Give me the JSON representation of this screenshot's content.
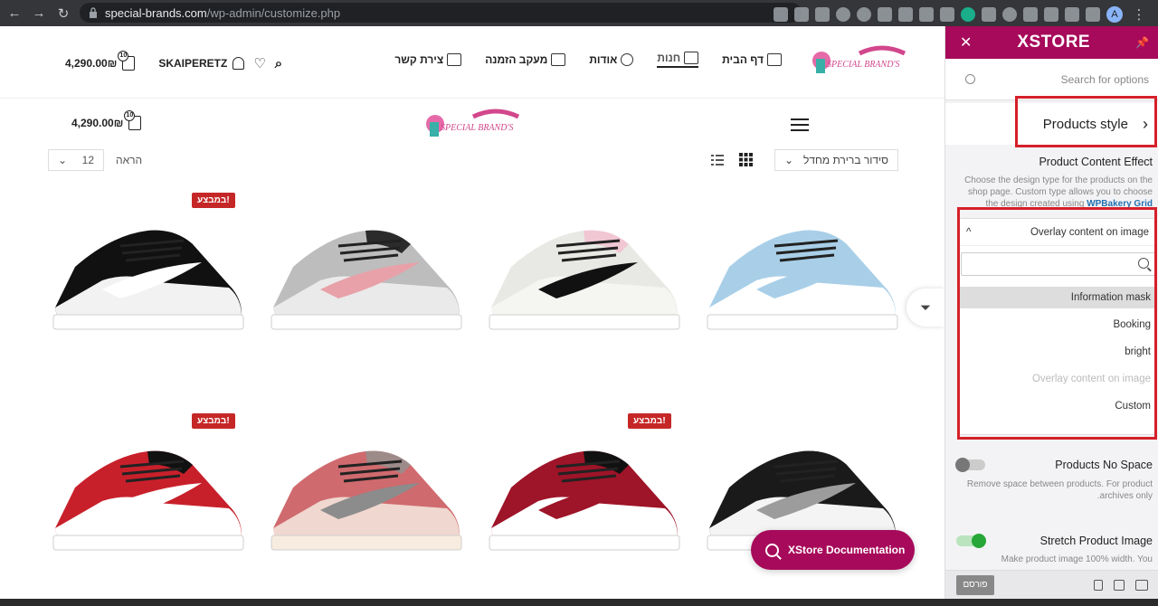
{
  "browser": {
    "url_host": "special-brands.com",
    "url_path": "/wp-admin/customize.php"
  },
  "site": {
    "logo_text": "SPECIAL BRAND'S",
    "menu": [
      {
        "label": "דף הבית"
      },
      {
        "label": "חנות"
      },
      {
        "label": "אודות"
      },
      {
        "label": "מעקב הזמנה"
      },
      {
        "label": "צירת קשר"
      }
    ],
    "cart_total": "4,290.00₪",
    "cart_count": "10",
    "username": "SKAIPERETZ",
    "cart_total_2": "4,290.00₪",
    "cart_count_2": "10",
    "per_page": "12",
    "show_label": "הראה",
    "sort_label": "סידור ברירת מחדל",
    "sale_label": "במבצע!",
    "doc_button": "XStore Documentation"
  },
  "products": [
    {
      "name": "black-white-low",
      "colors": {
        "upper": "#111111",
        "swoosh": "#ffffff",
        "toe": "#f2f2f2",
        "sole": "#ffffff"
      },
      "sale": true
    },
    {
      "name": "grey-pink-low",
      "colors": {
        "upper": "#bdbdbd",
        "swoosh": "#e8a1a8",
        "toe": "#eaeaea",
        "sole": "#ffffff",
        "collar": "#2b2b2b"
      },
      "sale": false
    },
    {
      "name": "white-black-pink-low",
      "colors": {
        "upper": "#e8e8e4",
        "swoosh": "#111111",
        "toe": "#f5f5f2",
        "sole": "#ffffff",
        "collar": "#f1c7d4"
      },
      "sale": false
    },
    {
      "name": "blue-white-low",
      "colors": {
        "upper": "#a9cfe8",
        "swoosh": "#a9cfe8",
        "toe": "#ffffff",
        "sole": "#ffffff",
        "collar": "#a9cfe8"
      },
      "sale": false
    },
    {
      "name": "red-black-white-low",
      "colors": {
        "upper": "#c8202b",
        "swoosh": "#ffffff",
        "toe": "#ffffff",
        "sole": "#ffffff",
        "collar": "#111111"
      },
      "sale": true
    },
    {
      "name": "pink-suede-low",
      "colors": {
        "upper": "#cf6a6e",
        "swoosh": "#8c8c8c",
        "toe": "#f0d7cf",
        "sole": "#f7ecdf",
        "collar": "#9d8b8a"
      },
      "sale": false
    },
    {
      "name": "white-red-black-low",
      "colors": {
        "upper": "#9e1428",
        "swoosh": "#9e1428",
        "toe": "#ffffff",
        "sole": "#ffffff",
        "collar": "#111111"
      },
      "sale": true
    },
    {
      "name": "black-grey-white-low",
      "colors": {
        "upper": "#1a1a1a",
        "swoosh": "#9c9c9c",
        "toe": "#f4f4f4",
        "sole": "#ffffff",
        "collar": "#1a1a1a"
      },
      "sale": false
    }
  ],
  "panel": {
    "brand": "XSTORE",
    "search_placeholder": "Search for options",
    "section": "Products style",
    "content_effect_title": "Product Content Effect",
    "content_effect_desc_1": "Choose the design type for the products on the shop page. Custom type allows you to choose the design created using ",
    "content_effect_link": "WPBakery Grid builder",
    "selected": "Overlay content on image",
    "options": [
      {
        "label": "Information mask",
        "state": "hover"
      },
      {
        "label": "Booking",
        "state": "normal"
      },
      {
        "label": "bright",
        "state": "normal"
      },
      {
        "label": "Overlay content on image",
        "state": "disabled"
      },
      {
        "label": "Custom",
        "state": "normal"
      }
    ],
    "no_space_title": "Products No Space",
    "no_space_desc": "Remove space between products. For product archives only.",
    "no_space_on": false,
    "stretch_title": "Stretch Product Image",
    "stretch_desc": "Make product image 100% width. You",
    "stretch_on": true,
    "publish_label": "פורסם"
  },
  "colors": {
    "brand": "#a70a5a",
    "highlight": "#d6202a",
    "sale": "#c52727"
  }
}
